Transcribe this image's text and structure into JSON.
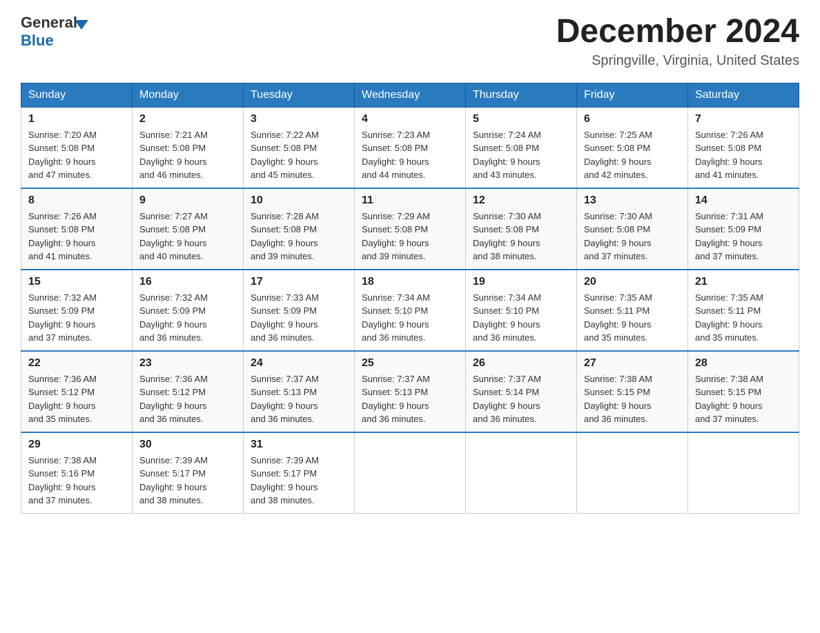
{
  "header": {
    "logo": {
      "general_text": "General",
      "blue_text": "Blue"
    },
    "title": "December 2024",
    "location": "Springville, Virginia, United States"
  },
  "weekdays": [
    "Sunday",
    "Monday",
    "Tuesday",
    "Wednesday",
    "Thursday",
    "Friday",
    "Saturday"
  ],
  "weeks": [
    [
      {
        "day": "1",
        "sunrise": "7:20 AM",
        "sunset": "5:08 PM",
        "daylight": "9 hours and 47 minutes."
      },
      {
        "day": "2",
        "sunrise": "7:21 AM",
        "sunset": "5:08 PM",
        "daylight": "9 hours and 46 minutes."
      },
      {
        "day": "3",
        "sunrise": "7:22 AM",
        "sunset": "5:08 PM",
        "daylight": "9 hours and 45 minutes."
      },
      {
        "day": "4",
        "sunrise": "7:23 AM",
        "sunset": "5:08 PM",
        "daylight": "9 hours and 44 minutes."
      },
      {
        "day": "5",
        "sunrise": "7:24 AM",
        "sunset": "5:08 PM",
        "daylight": "9 hours and 43 minutes."
      },
      {
        "day": "6",
        "sunrise": "7:25 AM",
        "sunset": "5:08 PM",
        "daylight": "9 hours and 42 minutes."
      },
      {
        "day": "7",
        "sunrise": "7:26 AM",
        "sunset": "5:08 PM",
        "daylight": "9 hours and 41 minutes."
      }
    ],
    [
      {
        "day": "8",
        "sunrise": "7:26 AM",
        "sunset": "5:08 PM",
        "daylight": "9 hours and 41 minutes."
      },
      {
        "day": "9",
        "sunrise": "7:27 AM",
        "sunset": "5:08 PM",
        "daylight": "9 hours and 40 minutes."
      },
      {
        "day": "10",
        "sunrise": "7:28 AM",
        "sunset": "5:08 PM",
        "daylight": "9 hours and 39 minutes."
      },
      {
        "day": "11",
        "sunrise": "7:29 AM",
        "sunset": "5:08 PM",
        "daylight": "9 hours and 39 minutes."
      },
      {
        "day": "12",
        "sunrise": "7:30 AM",
        "sunset": "5:08 PM",
        "daylight": "9 hours and 38 minutes."
      },
      {
        "day": "13",
        "sunrise": "7:30 AM",
        "sunset": "5:08 PM",
        "daylight": "9 hours and 37 minutes."
      },
      {
        "day": "14",
        "sunrise": "7:31 AM",
        "sunset": "5:09 PM",
        "daylight": "9 hours and 37 minutes."
      }
    ],
    [
      {
        "day": "15",
        "sunrise": "7:32 AM",
        "sunset": "5:09 PM",
        "daylight": "9 hours and 37 minutes."
      },
      {
        "day": "16",
        "sunrise": "7:32 AM",
        "sunset": "5:09 PM",
        "daylight": "9 hours and 36 minutes."
      },
      {
        "day": "17",
        "sunrise": "7:33 AM",
        "sunset": "5:09 PM",
        "daylight": "9 hours and 36 minutes."
      },
      {
        "day": "18",
        "sunrise": "7:34 AM",
        "sunset": "5:10 PM",
        "daylight": "9 hours and 36 minutes."
      },
      {
        "day": "19",
        "sunrise": "7:34 AM",
        "sunset": "5:10 PM",
        "daylight": "9 hours and 36 minutes."
      },
      {
        "day": "20",
        "sunrise": "7:35 AM",
        "sunset": "5:11 PM",
        "daylight": "9 hours and 35 minutes."
      },
      {
        "day": "21",
        "sunrise": "7:35 AM",
        "sunset": "5:11 PM",
        "daylight": "9 hours and 35 minutes."
      }
    ],
    [
      {
        "day": "22",
        "sunrise": "7:36 AM",
        "sunset": "5:12 PM",
        "daylight": "9 hours and 35 minutes."
      },
      {
        "day": "23",
        "sunrise": "7:36 AM",
        "sunset": "5:12 PM",
        "daylight": "9 hours and 36 minutes."
      },
      {
        "day": "24",
        "sunrise": "7:37 AM",
        "sunset": "5:13 PM",
        "daylight": "9 hours and 36 minutes."
      },
      {
        "day": "25",
        "sunrise": "7:37 AM",
        "sunset": "5:13 PM",
        "daylight": "9 hours and 36 minutes."
      },
      {
        "day": "26",
        "sunrise": "7:37 AM",
        "sunset": "5:14 PM",
        "daylight": "9 hours and 36 minutes."
      },
      {
        "day": "27",
        "sunrise": "7:38 AM",
        "sunset": "5:15 PM",
        "daylight": "9 hours and 36 minutes."
      },
      {
        "day": "28",
        "sunrise": "7:38 AM",
        "sunset": "5:15 PM",
        "daylight": "9 hours and 37 minutes."
      }
    ],
    [
      {
        "day": "29",
        "sunrise": "7:38 AM",
        "sunset": "5:16 PM",
        "daylight": "9 hours and 37 minutes."
      },
      {
        "day": "30",
        "sunrise": "7:39 AM",
        "sunset": "5:17 PM",
        "daylight": "9 hours and 38 minutes."
      },
      {
        "day": "31",
        "sunrise": "7:39 AM",
        "sunset": "5:17 PM",
        "daylight": "9 hours and 38 minutes."
      },
      null,
      null,
      null,
      null
    ]
  ]
}
